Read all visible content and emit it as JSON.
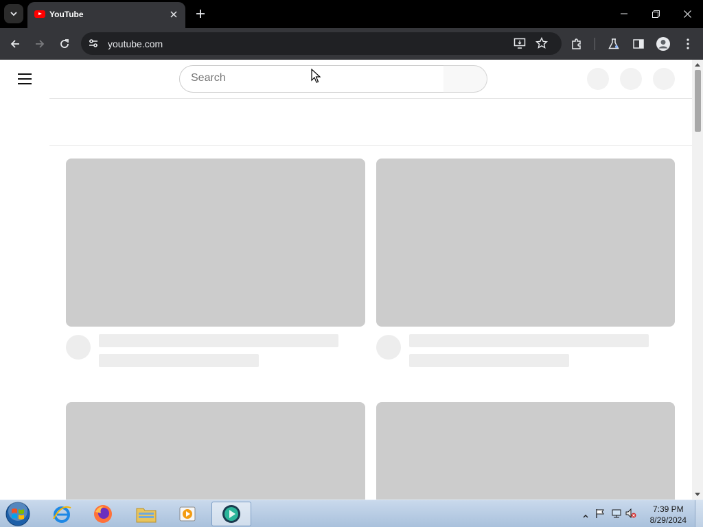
{
  "browser": {
    "tab_title": "YouTube",
    "url": "youtube.com"
  },
  "youtube": {
    "search_placeholder": "Search"
  },
  "taskbar": {
    "time": "7:39 PM",
    "date": "8/29/2024",
    "apps": [
      "internet-explorer",
      "firefox",
      "file-explorer",
      "media-player",
      "active-app"
    ]
  }
}
